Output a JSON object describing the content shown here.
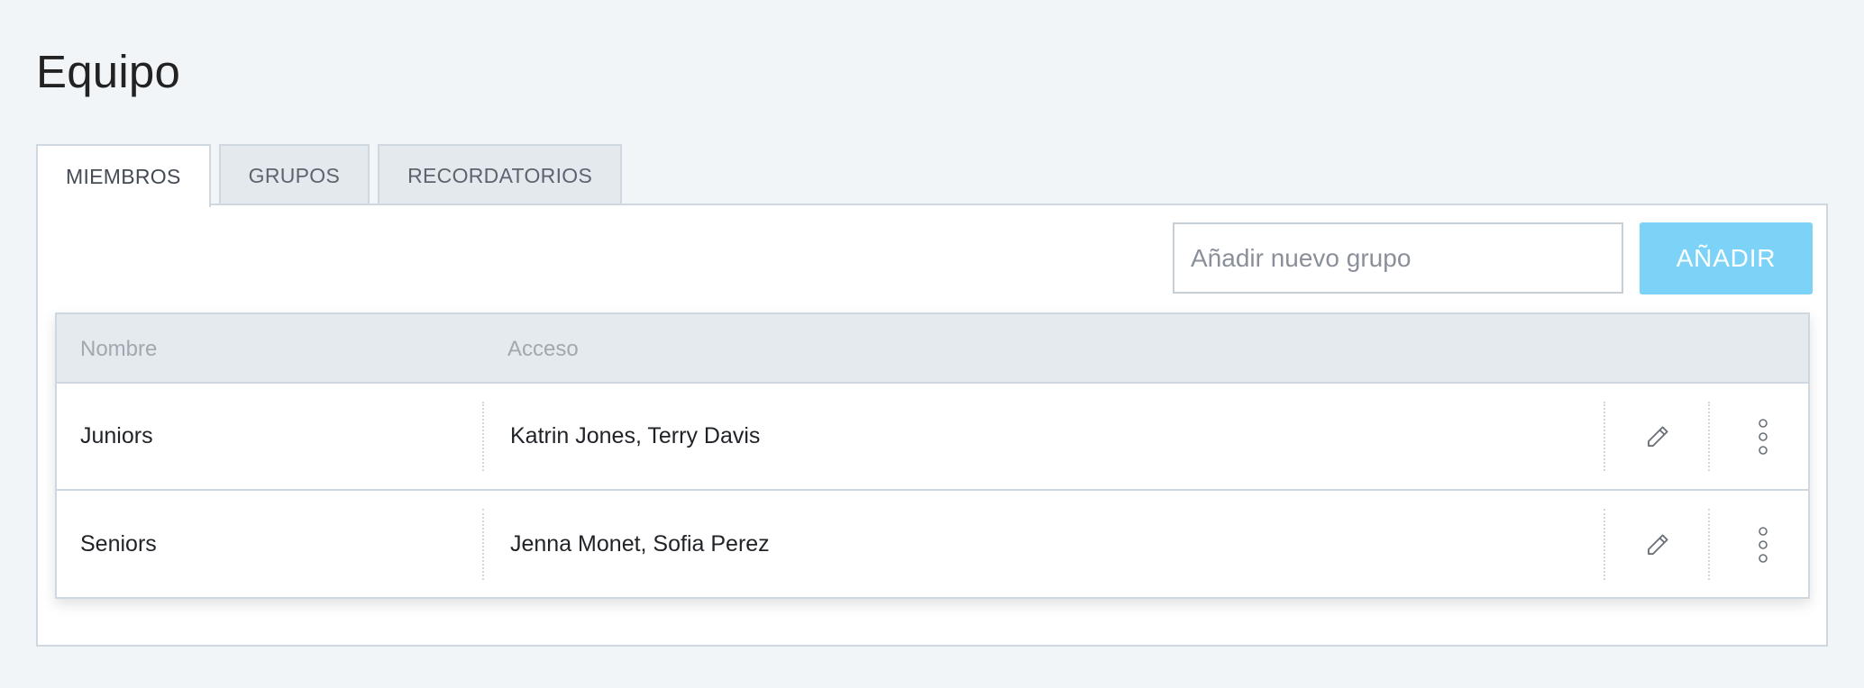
{
  "page": {
    "title": "Equipo"
  },
  "tabs": [
    {
      "label": "MIEMBROS",
      "active": true
    },
    {
      "label": "GRUPOS",
      "active": false
    },
    {
      "label": "RECORDATORIOS",
      "active": false
    }
  ],
  "toolbar": {
    "new_group_placeholder": "Añadir nuevo grupo",
    "new_group_value": "",
    "add_label": "AÑADIR",
    "add_color": "#7dd3f7"
  },
  "table": {
    "headers": {
      "name": "Nombre",
      "access": "Acceso"
    },
    "rows": [
      {
        "name": "Juniors",
        "access": "Katrin Jones, Terry Davis",
        "edit_icon": "pencil-icon",
        "more_icon": "more-vertical-icon"
      },
      {
        "name": "Seniors",
        "access": "Jenna Monet, Sofia Perez",
        "edit_icon": "pencil-icon",
        "more_icon": "more-vertical-icon"
      }
    ]
  }
}
